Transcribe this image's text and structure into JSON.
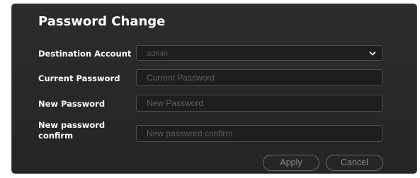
{
  "dialog": {
    "title": "Password Change"
  },
  "form": {
    "destination_account": {
      "label": "Destination Account",
      "value": "admin"
    },
    "current_password": {
      "label": "Current Password",
      "placeholder": "Current Password",
      "value": ""
    },
    "new_password": {
      "label": "New Password",
      "placeholder": "New Password",
      "value": ""
    },
    "new_password_confirm": {
      "label_line1": "New password",
      "label_line2": "confirm",
      "placeholder": "New password confirm",
      "value": ""
    }
  },
  "buttons": {
    "apply": "Apply",
    "cancel": "Cancel"
  },
  "icons": {
    "dropdown": "chevron-down-icon"
  },
  "colors": {
    "background": "#2a2a2a",
    "field_background": "#1e1e1e",
    "field_border": "#4d4d4d",
    "text": "#ffffff",
    "placeholder": "#5f5f5f",
    "button_border": "#6a6a6a"
  }
}
